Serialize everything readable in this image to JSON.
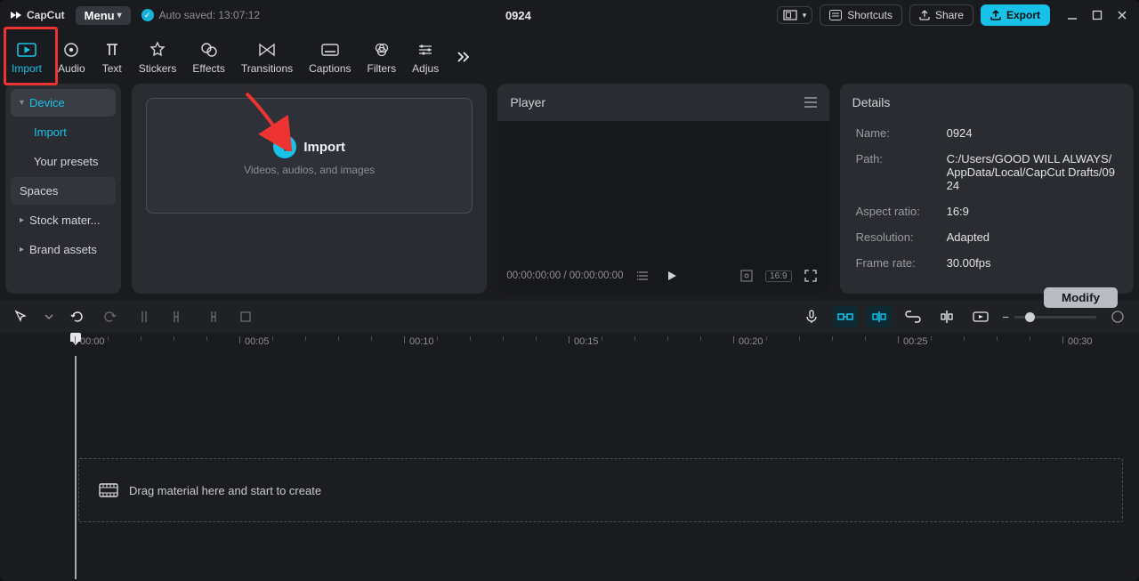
{
  "app": {
    "name": "CapCut"
  },
  "titlebar": {
    "menu": "Menu",
    "autosaved": "Auto saved: 13:07:12",
    "project": "0924"
  },
  "actions": {
    "shortcuts": "Shortcuts",
    "share": "Share",
    "export": "Export"
  },
  "ribbon": {
    "items": [
      "Import",
      "Audio",
      "Text",
      "Stickers",
      "Effects",
      "Transitions",
      "Captions",
      "Filters",
      "Adjus"
    ]
  },
  "mediaSidebar": {
    "device": "Device",
    "import": "Import",
    "presets": "Your presets",
    "spaces": "Spaces",
    "stock": "Stock mater...",
    "brand": "Brand assets"
  },
  "importCard": {
    "title": "Import",
    "sub": "Videos, audios, and images"
  },
  "player": {
    "title": "Player",
    "timecode": "00:00:00:00 / 00:00:00:00",
    "ratio": "16:9"
  },
  "details": {
    "title": "Details",
    "nameK": "Name:",
    "nameV": "0924",
    "pathK": "Path:",
    "pathV": "C:/Users/GOOD WILL ALWAYS/AppData/Local/CapCut Drafts/0924",
    "aspectK": "Aspect ratio:",
    "aspectV": "16:9",
    "resK": "Resolution:",
    "resV": "Adapted",
    "fpsK": "Frame rate:",
    "fpsV": "30.00fps",
    "modify": "Modify"
  },
  "timeline": {
    "marks": [
      "00:00",
      "00:05",
      "00:10",
      "00:15",
      "00:20",
      "00:25",
      "00:30"
    ],
    "dropHint": "Drag material here and start to create"
  }
}
